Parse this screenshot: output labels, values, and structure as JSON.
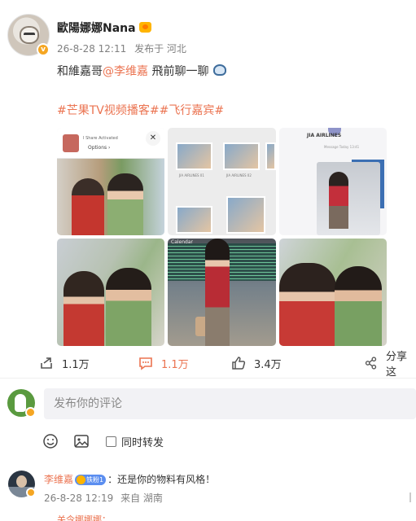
{
  "post": {
    "author": "歐陽娜娜Nana",
    "date": "26-8-28 12:11",
    "source": "发布于 河北",
    "text_prefix": "和維嘉哥",
    "mention": "@李维嘉",
    "text_suffix": " 飛前聊一聊",
    "hashtags": "#芒果TV视频播客##飞行嘉宾#"
  },
  "photos": {
    "p1_top_small": "I Share Activated",
    "p1_top_options": "Options ›",
    "p2_caption_a": "JIA AIRLINES 01",
    "p2_caption_b": "JIA AIRLINES 02",
    "p3_airline": "JIA AIRLINES",
    "p3_small": "Message\nToday 13:41",
    "p5_label": "Calendar"
  },
  "actions": {
    "share_count": "1.1万",
    "comment_count": "1.1万",
    "like_count": "3.4万",
    "share_label": "分享这"
  },
  "comment_input": {
    "placeholder": "发布你的评论",
    "repost_label": "同时转发"
  },
  "reply": {
    "name": "李维嘉",
    "fan_badge": "铁粉1",
    "text": "：还是你的物料有风格！",
    "date": "26-8-28 12:19",
    "source": "来自 湖南"
  },
  "next_reply": {
    "name": "关令娜娜娜",
    "text": "："
  },
  "colors": {
    "accent": "#eb7350",
    "verify": "#f5a623"
  }
}
